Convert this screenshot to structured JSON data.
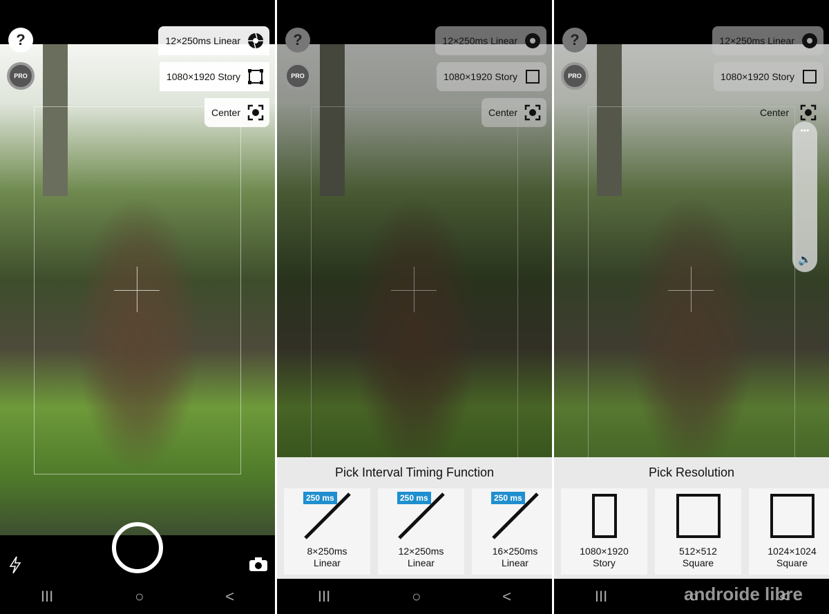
{
  "top_chips": {
    "timing": "12×250ms Linear",
    "resolution": "1080×1920 Story",
    "focus": "Center"
  },
  "buttons": {
    "help": "?",
    "pro": "PRO"
  },
  "timing_sheet": {
    "title": "Pick Interval Timing Function",
    "options": [
      {
        "badge": "250 ms",
        "line1": "8×250ms",
        "line2": "Linear"
      },
      {
        "badge": "250 ms",
        "line1": "12×250ms",
        "line2": "Linear"
      },
      {
        "badge": "250 ms",
        "line1": "16×250ms",
        "line2": "Linear"
      }
    ]
  },
  "resolution_sheet": {
    "title": "Pick Resolution",
    "options": [
      {
        "line1": "1080×1920",
        "line2": "Story",
        "shape": "portrait"
      },
      {
        "line1": "512×512",
        "line2": "Square",
        "shape": "square"
      },
      {
        "line1": "1024×1024",
        "line2": "Square",
        "shape": "square"
      }
    ]
  },
  "volume": {
    "menu": "•••",
    "icon": "🔊"
  },
  "nav": {
    "recents": "III",
    "home": "○",
    "back": "<"
  },
  "watermark": "androide libre",
  "colors": {
    "badge": "#1f8fcf",
    "sheet": "#e9e9e9"
  }
}
